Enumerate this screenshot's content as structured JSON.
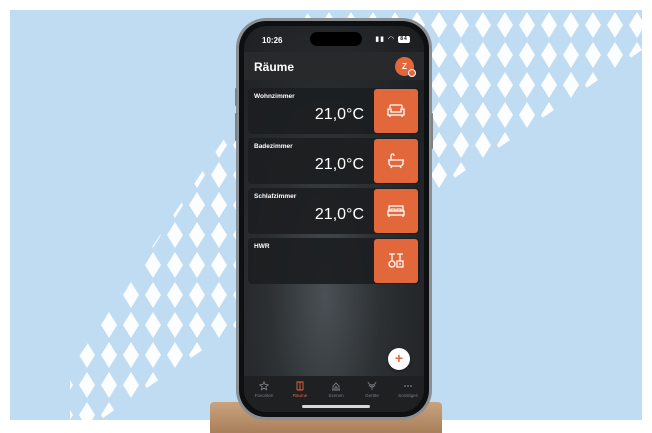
{
  "status_bar": {
    "time": "10:26",
    "battery": "84"
  },
  "header": {
    "title": "Räume",
    "avatar_initial": "Z"
  },
  "rooms": [
    {
      "name": "Wohnzimmer",
      "temperature": "21,0°C",
      "icon": "sofa-icon"
    },
    {
      "name": "Badezimmer",
      "temperature": "21,0°C",
      "icon": "bathtub-icon"
    },
    {
      "name": "Schlafzimmer",
      "temperature": "21,0°C",
      "icon": "bed-icon"
    },
    {
      "name": "HWR",
      "temperature": "",
      "icon": "utility-valve-icon"
    }
  ],
  "fab": {
    "label": "+"
  },
  "tabbar": {
    "tabs": [
      {
        "label": "Favoriten",
        "icon": "star-icon",
        "active": false
      },
      {
        "label": "Räume",
        "icon": "rooms-icon",
        "active": true
      },
      {
        "label": "Szenen",
        "icon": "scenes-icon",
        "active": false
      },
      {
        "label": "Geräte",
        "icon": "devices-icon",
        "active": false
      },
      {
        "label": "Sonstiges",
        "icon": "more-icon",
        "active": false
      }
    ]
  },
  "colors": {
    "accent": "#e2683c",
    "background": "#bfdcf3",
    "card": "#1c1e20"
  }
}
